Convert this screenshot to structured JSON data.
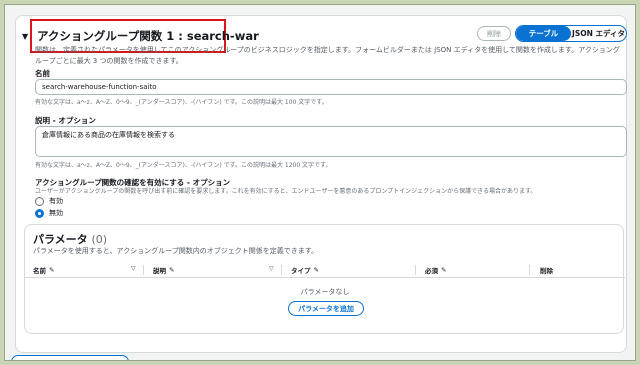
{
  "function": {
    "title": "アクショングループ関数 1 : search-war",
    "description": "関数は、定義されたパラメータを使用してこのアクショングループのビジネスロジックを指定します。フォームビルダーまたは JSON エディタを使用して関数を作成します。アクショングループごとに最大 3 つの関数を作成できます。",
    "delete_label": "削除",
    "tabs": [
      "テーブル",
      "JSON エディタ"
    ]
  },
  "name_field": {
    "label": "名前",
    "value": "search-warehouse-function-saito",
    "hint": "有効な文字は、a〜z、A〜Z、0〜9、_(アンダースコア)、-(ハイフン) です。この説明は最大 100 文字です。"
  },
  "description_field": {
    "label": "説明 - オプション",
    "value": "倉庫情報にある商品の在庫情報を検索する",
    "hint": "有効な文字は、a〜z、A〜Z、0〜9、_(アンダースコア)、-(ハイフン) です。この説明は最大 1200 文字です。"
  },
  "confirmation": {
    "label": "アクショングループ関数の確認を有効にする - オプション",
    "hint": "ユーザーがアクショングループの関数を呼び出す前に確認を要求します。これを有効にすると、エンドユーザーを悪意のあるプロンプトインジェクションから保護できる場合があります。",
    "options": [
      "有効",
      "無効"
    ],
    "selected": "無効"
  },
  "parameters": {
    "title": "パラメータ",
    "count": "(0)",
    "description": "パラメータを使用すると、アクショングループ関数内のオブジェクト関係を定義できます。",
    "columns": [
      "名前",
      "説明",
      "タイプ",
      "必須",
      "削除"
    ],
    "empty_text": "パラメータなし",
    "add_label": "パラメータを追加"
  },
  "colors": {
    "accent": "#0972d3",
    "highlight": "#d9161a"
  }
}
